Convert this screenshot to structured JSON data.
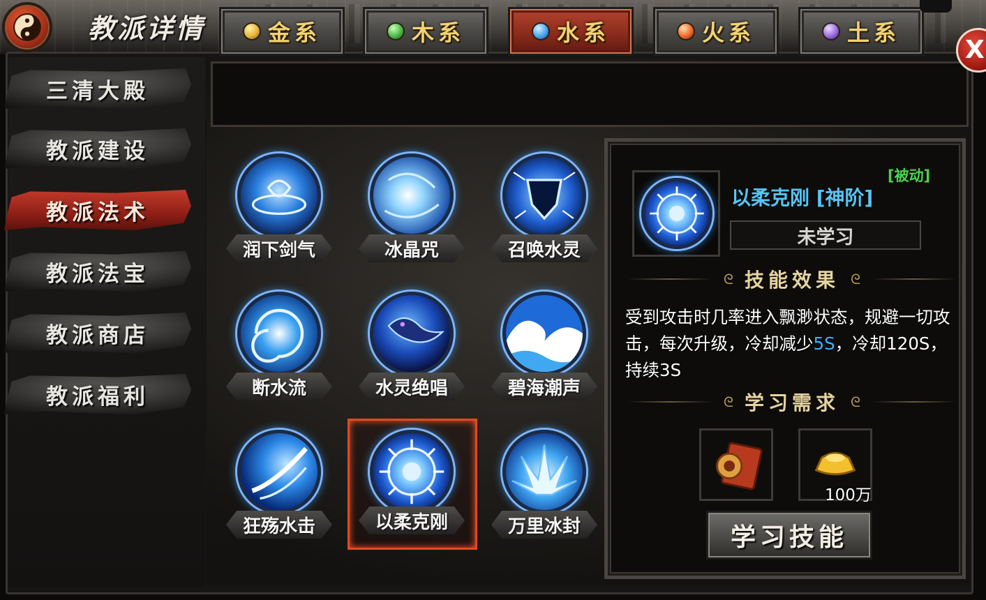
{
  "header": {
    "title": "教派详情",
    "close_label": "X"
  },
  "sidebar": {
    "items": [
      {
        "label": "三清大殿",
        "active": false
      },
      {
        "label": "教派建设",
        "active": false
      },
      {
        "label": "教派法术",
        "active": true
      },
      {
        "label": "教派法宝",
        "active": false
      },
      {
        "label": "教派商店",
        "active": false
      },
      {
        "label": "教派福利",
        "active": false
      }
    ]
  },
  "tabs": [
    {
      "label": "金系",
      "orb_color": "#e8b43a",
      "active": false
    },
    {
      "label": "木系",
      "orb_color": "#4fb848",
      "active": false
    },
    {
      "label": "水系",
      "orb_color": "#4aa6f0",
      "active": true
    },
    {
      "label": "火系",
      "orb_color": "#ef6a2a",
      "active": false
    },
    {
      "label": "土系",
      "orb_color": "#9b6be0",
      "active": false
    }
  ],
  "skills": [
    {
      "name": "润下剑气",
      "icon": "water-seal-icon"
    },
    {
      "name": "冰晶咒",
      "icon": "ice-orb-icon"
    },
    {
      "name": "召唤水灵",
      "icon": "water-shield-icon"
    },
    {
      "name": "断水流",
      "icon": "whirlpool-icon"
    },
    {
      "name": "水灵绝唱",
      "icon": "water-dragon-icon"
    },
    {
      "name": "碧海潮声",
      "icon": "tidal-wave-icon"
    },
    {
      "name": "狂殇水击",
      "icon": "water-slash-icon"
    },
    {
      "name": "以柔克刚",
      "icon": "spiked-orb-icon",
      "selected": true
    },
    {
      "name": "万里冰封",
      "icon": "ice-crystal-icon"
    }
  ],
  "detail": {
    "passive_tag": "[被动]",
    "skill_title": "以柔克刚 [神阶]",
    "status": "未学习",
    "effect_heading": "技能效果",
    "effect_text_1": "受到攻击时几率进入飘渺状态，规避一切攻击，每次升级，冷却减少",
    "effect_highlight": "5S",
    "effect_text_2": "，冷却120S，持续3S",
    "requirement_heading": "学习需求",
    "requirements": [
      {
        "icon": "skill-book-icon",
        "amount": ""
      },
      {
        "icon": "gold-ingot-icon",
        "amount": "100万"
      }
    ],
    "learn_button": "学习技能"
  },
  "colors": {
    "accent_red": "#8e1f16",
    "skill_title_blue": "#56c5f4",
    "passive_green": "#4ad24a",
    "tab_gold_text": "#f2d372",
    "highlight_blue": "#3ab4ff"
  }
}
